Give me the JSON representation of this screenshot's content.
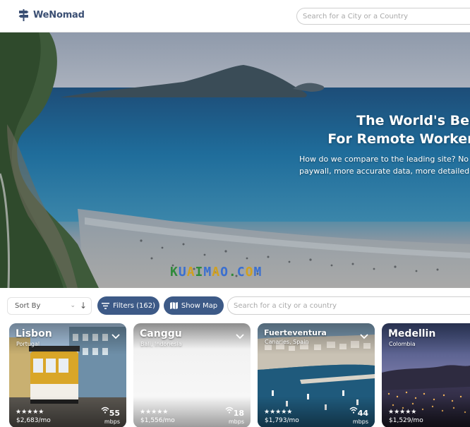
{
  "header": {
    "brand": "WeNomad",
    "search_placeholder": "Search for a City or a Country"
  },
  "hero": {
    "title_line1": "The World's Best C",
    "title_line2": "For Remote Workers &",
    "subtitle_line1": "How do we compare to the leading site? No",
    "subtitle_line2": "paywall, more accurate data, more detailed",
    "watermark": "KUAIMAO.COM"
  },
  "toolbar": {
    "sort_label": "Sort By",
    "filters_label": "Filters (162)",
    "map_label": "Show Map",
    "search_placeholder": "Search for a city or a country"
  },
  "colors": {
    "brand": "#3b4f73",
    "button": "#3d5a87"
  },
  "cards": [
    {
      "city": "Lisbon",
      "country": "Portugal",
      "stars": "★★★★★",
      "cost": "$2,683/mo",
      "speed": "55",
      "unit": "mbps"
    },
    {
      "city": "Canggu",
      "country": "Bali, Indonesia",
      "stars": "★★★★★",
      "cost": "$1,556/mo",
      "speed": "18",
      "unit": "mbps"
    },
    {
      "city": "Fuerteventura",
      "country": "Canaries, Spain",
      "stars": "★★★★★",
      "cost": "$1,793/mo",
      "speed": "44",
      "unit": "mbps"
    },
    {
      "city": "Medellin",
      "country": "Colombia",
      "stars": "★★★★★",
      "cost": "$1,529/mo",
      "speed": "",
      "unit": ""
    }
  ]
}
